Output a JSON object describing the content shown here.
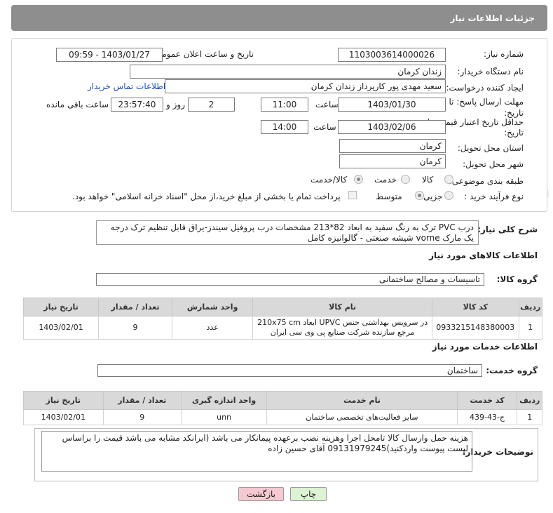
{
  "header": {
    "title": "جزئیات اطلاعات نیاز"
  },
  "form": {
    "need_number_label": "شماره نیاز:",
    "need_number": "1103003614000026",
    "announce_label": "تاریخ و ساعت اعلان عمومی:",
    "announce_value": "1403/01/27 - 09:59",
    "buyer_org_label": "نام دستگاه خریدار:",
    "buyer_org": "زندان کرمان",
    "creator_label": "ایجاد کننده درخواست:",
    "creator": "سعید مهدی پور کارپرداز زندان کرمان",
    "contact_link": "اطلاعات تماس خریدار",
    "deadline_label_1": "مهلت ارسال پاسخ: تا",
    "deadline_label_2": "تاریخ:",
    "deadline_date": "1403/01/30",
    "time_label": "ساعت",
    "deadline_time": "11:00",
    "days_value": "2",
    "days_label": "روز و",
    "remaining_time": "23:57:40",
    "remaining_label": "ساعت باقی مانده",
    "validity_label_1": "حداقل تاریخ اعتبار قیمت: تا",
    "validity_label_2": "تاریخ:",
    "validity_date": "1403/02/06",
    "validity_time_label": "ساعت",
    "validity_time": "14:00",
    "province_label": "استان محل تحویل:",
    "province": "کرمان",
    "city_label": "شهر محل تحویل:",
    "city": "کرمان",
    "category_label": "طبقه بندی موضوعی:",
    "category_options": [
      "کالا",
      "خدمت",
      "کالا/خدمت"
    ],
    "purchase_type_label": "نوع فرآیند خرید :",
    "purchase_options": [
      "جزیی",
      "متوسط"
    ],
    "payment_note": "پرداخت تمام یا بخشی از مبلغ خرید،از محل \"اسناد خزانه اسلامی\" خواهد بود."
  },
  "description": {
    "label": "شرح کلی نیاز:",
    "text": "درب PVC ترک به رنگ سفید به ابعاد 82*213 مشخصات درب پروفیل سیندز-یراق قابل تنظیم ترک درجه یک مارک vorne شیشه صنعتی - گالوانیزه کامل"
  },
  "goods": {
    "section_title": "اطلاعات کالاهای مورد نیاز",
    "group_label": "گروه کالا:",
    "group_value": "تاسیسات و مصالح ساختمانی",
    "columns": [
      "ردیف",
      "کد کالا",
      "نام کالا",
      "واحد شمارش",
      "تعداد / مقدار",
      "تاریخ نیاز"
    ],
    "rows": [
      {
        "index": "1",
        "code": "0933215148380003",
        "name": "در سرویس بهداشتی جنس UPVC ابعاد 210x75 cm مرجع سازنده شرکت صنایع پی وی سی ایران",
        "unit": "عدد",
        "qty": "9",
        "date": "1403/02/01"
      }
    ]
  },
  "services": {
    "section_title": "اطلاعات خدمات مورد نیاز",
    "group_label": "گروه خدمت:",
    "group_value": "ساختمان",
    "columns": [
      "ردیف",
      "کد خدمت",
      "نام خدمت",
      "واحد اندازه گیری",
      "تعداد / مقدار",
      "تاریخ نیاز"
    ],
    "rows": [
      {
        "index": "1",
        "code": "ج-43-439",
        "name": "سایر فعالیت‌های تخصصی ساختمان",
        "unit": "unn",
        "qty": "9",
        "date": "1403/02/01"
      }
    ]
  },
  "buyer_notes": {
    "label": "توضیحات خریدار:",
    "text": "هزینه حمل وارسال کالا تامحل اجرا وهزینه نصب برعهده پیمانکار می باشد (ایرانکد مشابه می باشد قیمت را براساس لیست پیوست واردکنید)09131979245 آقای حسین زاده"
  },
  "buttons": {
    "print": "چاپ",
    "back": "بازگشت"
  },
  "watermark": "AriaTender.net",
  "colors": {
    "header_bg": "#8e8e8e",
    "back_button_bg": "#f6c9d0",
    "print_button_bg": "#dcf3d4",
    "link": "#1a4fb5"
  }
}
